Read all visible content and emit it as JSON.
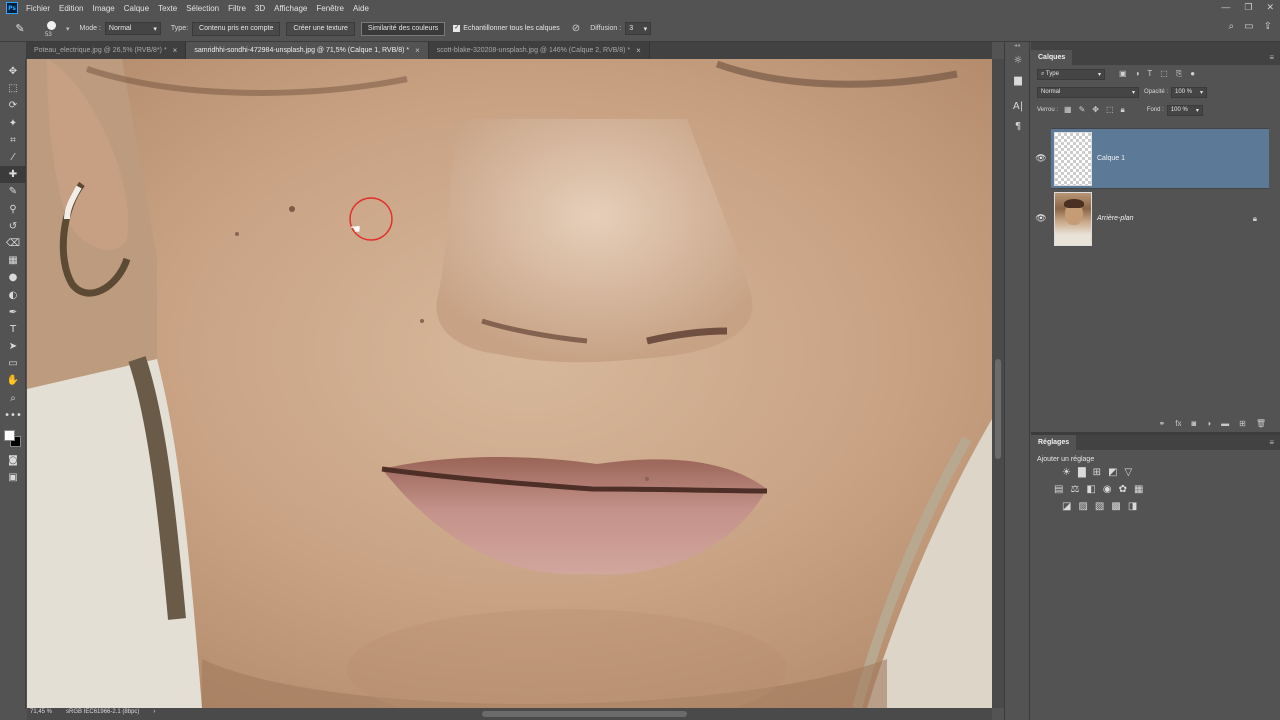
{
  "app": {
    "logo_text": "Ps"
  },
  "menu": [
    "Fichier",
    "Edition",
    "Image",
    "Calque",
    "Texte",
    "Sélection",
    "Filtre",
    "3D",
    "Affichage",
    "Fenêtre",
    "Aide"
  ],
  "options": {
    "brush_size": "53",
    "mode_label": "Mode :",
    "mode_value": "Normal",
    "type_label": "Type:",
    "btn_content_aware": "Contenu pris en compte",
    "btn_create_texture": "Créer une texture",
    "btn_color_similarity": "Similarité des couleurs",
    "sample_all_label": "Echantillonner tous les calques",
    "diffusion_label": "Diffusion :",
    "diffusion_value": "3"
  },
  "doc_tabs": [
    {
      "label": "Poteau_electrique.jpg @ 26,5% (RVB/8*) *",
      "active": false
    },
    {
      "label": "samridhhi-sondhi-472984-unsplash.jpg @ 71,5% (Calque 1, RVB/8) *",
      "active": true
    },
    {
      "label": "scott-blake-320208-unsplash.jpg @ 146% (Calque 2, RVB/8) *",
      "active": false
    }
  ],
  "status": {
    "zoom": "71,45 %",
    "profile": "sRGB IEC61966-2.1 (8bpc)"
  },
  "layers_panel": {
    "title": "Calques",
    "filter_label": "Type",
    "blend_mode": "Normal",
    "opacity_label": "Opacité :",
    "opacity_value": "100 %",
    "lock_label": "Verrou :",
    "fill_label": "Fond :",
    "fill_value": "100 %",
    "layers": [
      {
        "name": "Calque 1",
        "selected": true
      },
      {
        "name": "Arrière-plan",
        "selected": false,
        "locked": true
      }
    ]
  },
  "adjustments_panel": {
    "title": "Réglages",
    "add_label": "Ajouter un réglage"
  },
  "colors": {
    "foreground": "#ffffff",
    "background": "#000000",
    "selection": "#5c7a98",
    "cursor_ring": "#e0312d"
  }
}
